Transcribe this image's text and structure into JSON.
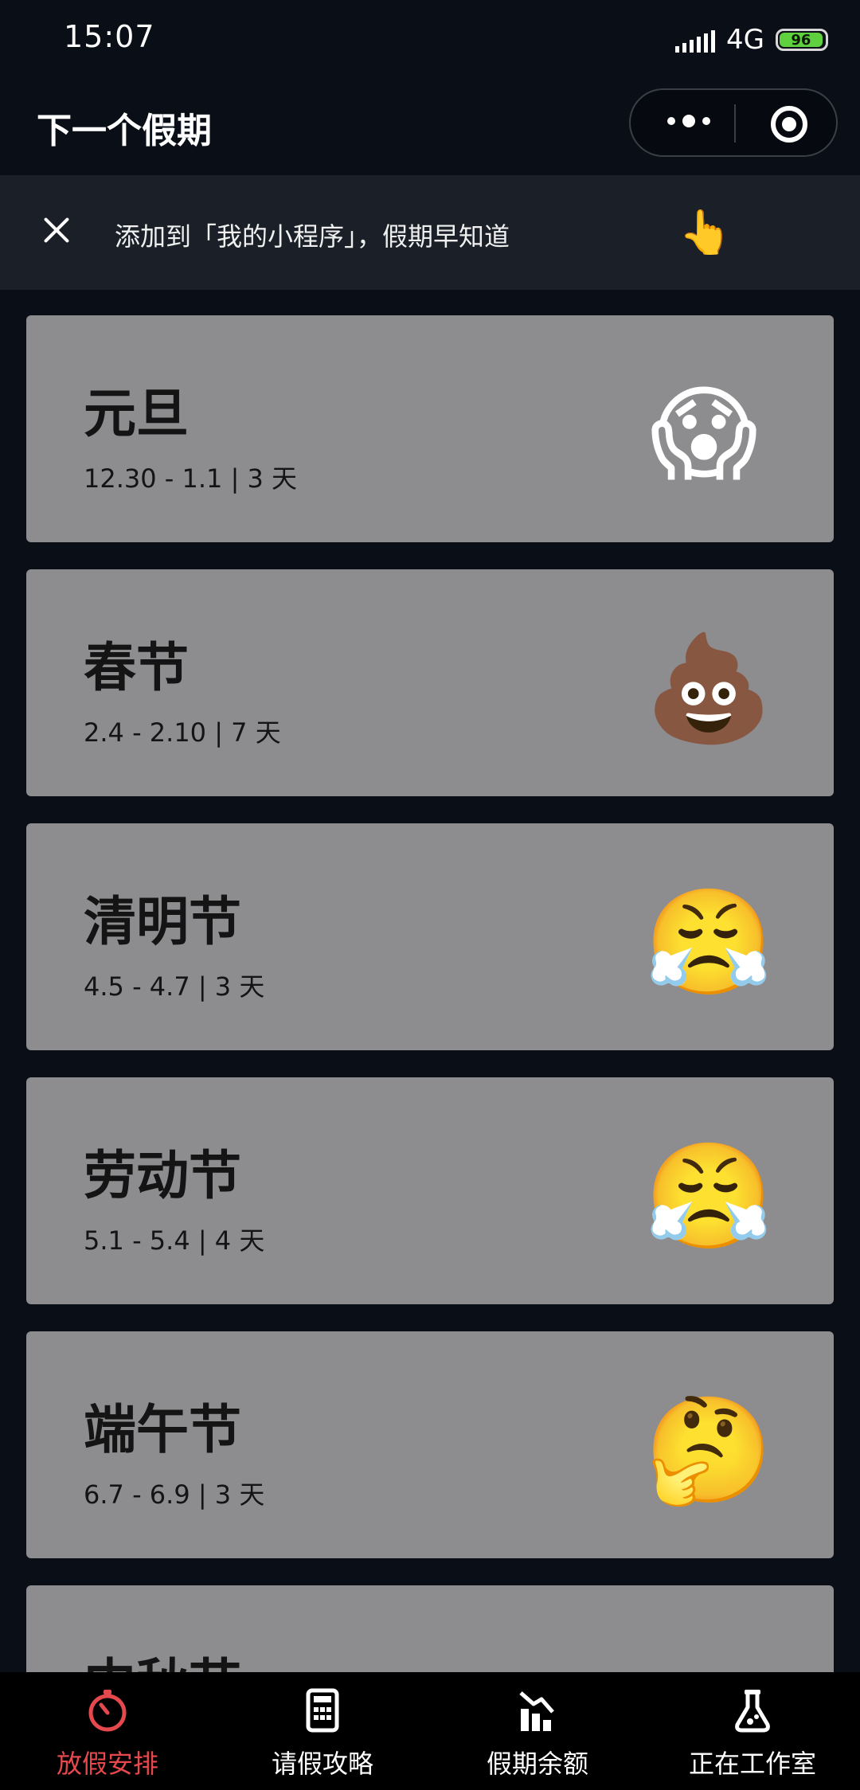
{
  "status_bar": {
    "time": "15:07",
    "network": "4G",
    "battery": "96",
    "battery_level": 0.96,
    "battery_color": "#5fd13f"
  },
  "header": {
    "title": "下一个假期",
    "more_icon": "more-dots-icon",
    "close_icon": "target-circle-icon"
  },
  "tip": {
    "text": "添加到「我的小程序」，假期早知道",
    "hand_emoji": "👆"
  },
  "holidays": [
    {
      "name": "元旦",
      "dates": "12.30 - 1.1",
      "days": "3 天",
      "emoji": "😱"
    },
    {
      "name": "春节",
      "dates": "2.4 - 2.10",
      "days": "7 天",
      "emoji": "💩"
    },
    {
      "name": "清明节",
      "dates": "4.5 - 4.7",
      "days": "3 天",
      "emoji": "😤"
    },
    {
      "name": "劳动节",
      "dates": "5.1 - 5.4",
      "days": "4 天",
      "emoji": "😤"
    },
    {
      "name": "端午节",
      "dates": "6.7 - 6.9",
      "days": "3 天",
      "emoji": "🤔"
    },
    {
      "name": "中秋节",
      "dates": "",
      "days": "",
      "emoji": ""
    }
  ],
  "tabbar": {
    "accent_color": "#e5484d",
    "tabs": [
      {
        "label": "放假安排",
        "icon": "stopwatch-icon",
        "active": true
      },
      {
        "label": "请假攻略",
        "icon": "calculator-icon",
        "active": false
      },
      {
        "label": "假期余额",
        "icon": "chart-decline-icon",
        "active": false
      },
      {
        "label": "正在工作室",
        "icon": "flask-icon",
        "active": false
      }
    ]
  }
}
